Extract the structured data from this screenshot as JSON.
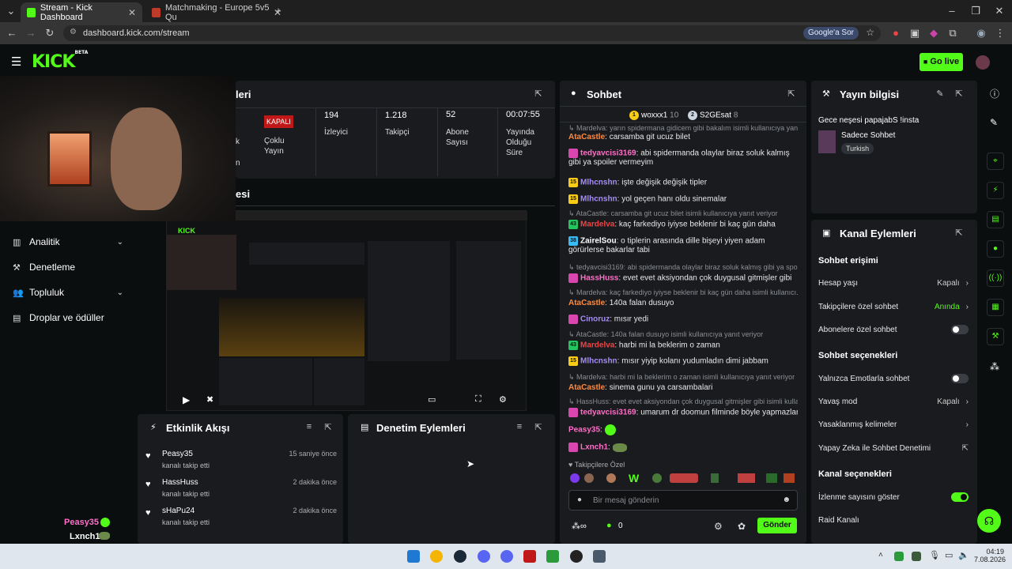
{
  "browser": {
    "tabs": [
      {
        "title": "Stream - Kick Dashboard",
        "active": true
      },
      {
        "title": "Matchmaking - Europe 5v5 Qu",
        "active": false
      }
    ],
    "url": "dashboard.kick.com/stream",
    "google_pill": "Google'a Sor"
  },
  "header": {
    "logo": "KICK",
    "logo_badge": "BETA",
    "go_live": "Go live"
  },
  "sidebar": {
    "items": [
      {
        "label": "Analitik",
        "icon": "chart-icon",
        "has_chevron": true
      },
      {
        "label": "Denetleme",
        "icon": "wrench-icon",
        "has_chevron": false
      },
      {
        "label": "Topluluk",
        "icon": "people-icon",
        "has_chevron": true
      },
      {
        "label": "Droplar ve ödüller",
        "icon": "gift-icon",
        "has_chevron": false
      }
    ],
    "overlay_chat": [
      {
        "user": "Peasy35"
      },
      {
        "user": "Lxnch1"
      }
    ]
  },
  "stats": {
    "title_fragment": "leri",
    "status_badge": "KAPALI",
    "status_label": "Çoklu Yayın",
    "left_fragment_1": "k",
    "left_fragment_2": "n",
    "viewers": {
      "value": "194",
      "label": "İzleyici"
    },
    "followers": {
      "value": "1.218",
      "label": "Takipçi"
    },
    "subs": {
      "value": "52",
      "label": "Abone Sayısı"
    },
    "uptime": {
      "value": "00:07:55",
      "label": "Yayında Olduğu Süre"
    }
  },
  "preview": {
    "title_fragment": "esi"
  },
  "events": {
    "title": "Etkinlik Akışı",
    "items": [
      {
        "user": "Peasy35",
        "action": "kanalı takip etti",
        "time": "15 saniye önce"
      },
      {
        "user": "HassHuss",
        "action": "kanalı takip etti",
        "time": "2 dakika önce"
      },
      {
        "user": "sHaPu24",
        "action": "kanalı takip etti",
        "time": "2 dakika önce"
      }
    ]
  },
  "moderation": {
    "title": "Denetim Eylemleri"
  },
  "chat": {
    "title": "Sohbet",
    "pinned": [
      {
        "user": "woxxx1",
        "count": "10"
      },
      {
        "user": "S2GEsat",
        "count": "8"
      }
    ],
    "messages": [
      {
        "type": "ctx",
        "text": "Mardelva: yarın spidermana gidicem gibi bakalım isimli kullanıcıya yan..."
      },
      {
        "type": "msg",
        "user": "AtaCastle",
        "color": "#ff8a3d",
        "text": "carsamba git ucuz bilet"
      },
      {
        "type": "msg",
        "user": "tedyavcisi3169",
        "color": "#ff6ec7",
        "badge": "#d946b0",
        "text": "abi spidermanda olaylar biraz soluk kalmış gibi ya spoiler vermeyim"
      },
      {
        "type": "msg",
        "user": "Mlhcnshn",
        "color": "#a78bfa",
        "badge": "#facc15",
        "badge_text": "15",
        "text": "işte değişik değişik tipler"
      },
      {
        "type": "msg",
        "user": "Mlhcnshn",
        "color": "#a78bfa",
        "badge": "#facc15",
        "badge_text": "15",
        "text": "yol geçen hanı oldu sinemalar"
      },
      {
        "type": "ctx",
        "text": "AtaCastle: carsamba git ucuz bilet isimli kullanıcıya yanıt veriyor"
      },
      {
        "type": "msg",
        "user": "Mardelva",
        "color": "#ef4444",
        "badge": "#22c55e",
        "badge_text": "43",
        "text": "kaç farkediyo iyiyse beklenir bi kaç gün daha"
      },
      {
        "type": "msg",
        "user": "ZairelSou",
        "color": "#ffffff",
        "badge": "#38bdf8",
        "badge_text": "38",
        "text": "o tiplerin arasında dille bişeyi yiyen adam görürlerse bakarlar tabi"
      },
      {
        "type": "ctx",
        "text": "tedyavcisi3169: abi spidermanda olaylar biraz soluk kalmış gibi ya spo..."
      },
      {
        "type": "msg",
        "user": "HassHuss",
        "color": "#ff6ec7",
        "badge": "#d946b0",
        "text": "evet evet aksiyondan çok duygusal gitmişler gibi"
      },
      {
        "type": "ctx",
        "text": "Mardelva: kaç farkediyo iyiyse beklenir bi kaç gün daha isimli kullanıcı..."
      },
      {
        "type": "msg",
        "user": "AtaCastle",
        "color": "#ff8a3d",
        "text": "140a falan dusuyo"
      },
      {
        "type": "msg",
        "user": "Cinoruz",
        "color": "#a78bfa",
        "badge": "#d946b0",
        "text": "mısır yedi"
      },
      {
        "type": "ctx",
        "text": "AtaCastle: 140a falan dusuyo isimli kullanıcıya yanıt veriyor"
      },
      {
        "type": "msg",
        "user": "Mardelva",
        "color": "#ef4444",
        "badge": "#22c55e",
        "badge_text": "43",
        "text": "harbi mi la beklerim o zaman"
      },
      {
        "type": "msg",
        "user": "Mlhcnshn",
        "color": "#a78bfa",
        "badge": "#facc15",
        "badge_text": "15",
        "text": "mısır yiyip kolanı yudumladın dimi jabbam"
      },
      {
        "type": "ctx",
        "text": "Mardelva: harbi mi la beklerim o zaman isimli kullanıcıya yanıt veriyor"
      },
      {
        "type": "msg",
        "user": "AtaCastle",
        "color": "#ff8a3d",
        "text": "sinema gunu ya carsambalari"
      },
      {
        "type": "ctx",
        "text": "HassHuss: evet evet aksiyondan çok duygusal gitmişler gibi isimli kulla..."
      },
      {
        "type": "msg",
        "user": "tedyavcisi3169",
        "color": "#ff6ec7",
        "badge": "#d946b0",
        "text": "umarum dr doomun filminde böyle yapmazlar"
      },
      {
        "type": "msg",
        "user": "Peasy35",
        "color": "#ff6ec7",
        "text": ""
      },
      {
        "type": "msg",
        "user": "Lxnch1",
        "color": "#ff6ec7",
        "badge": "#d946b0",
        "text": ""
      }
    ],
    "followers_only_label": "Takipçilere Özel",
    "input_placeholder": "Bir mesaj gönderin",
    "kicks_count": "0",
    "send_label": "Gönder"
  },
  "stream_info": {
    "title": "Yayın bilgisi",
    "stream_title": "Gece neşesi papajabS !insta",
    "category": "Sadece Sohbet",
    "tag": "Turkish"
  },
  "channel_actions": {
    "title": "Kanal Eylemleri",
    "sections": [
      {
        "heading": "Sohbet erişimi",
        "rows": [
          {
            "label": "Hesap yaşı",
            "value": "Kapalı",
            "kind": "chevron"
          },
          {
            "label": "Takipçilere özel sohbet",
            "value": "Anında",
            "kind": "chevron",
            "accent": true
          },
          {
            "label": "Abonelere özel sohbet",
            "kind": "toggle",
            "on": false
          }
        ]
      },
      {
        "heading": "Sohbet seçenekleri",
        "rows": [
          {
            "label": "Yalnızca Emotlarla sohbet",
            "kind": "toggle",
            "on": false
          },
          {
            "label": "Yavaş mod",
            "value": "Kapalı",
            "kind": "chevron"
          },
          {
            "label": "Yasaklanmış kelimeler",
            "kind": "chevron"
          },
          {
            "label": "Yapay Zeka ile Sohbet Denetimi",
            "kind": "external"
          }
        ]
      },
      {
        "heading": "Kanal seçenekleri",
        "rows": [
          {
            "label": "İzlenme sayısını göster",
            "kind": "toggle",
            "on": true
          },
          {
            "label": "Raid Kanalı",
            "kind": "none"
          }
        ]
      }
    ]
  },
  "taskbar": {
    "time": "04:19",
    "date": "7.08.2026"
  },
  "colors": {
    "accent": "#53fc18",
    "panel": "#191b1f",
    "bg": "#0b0e0f"
  }
}
